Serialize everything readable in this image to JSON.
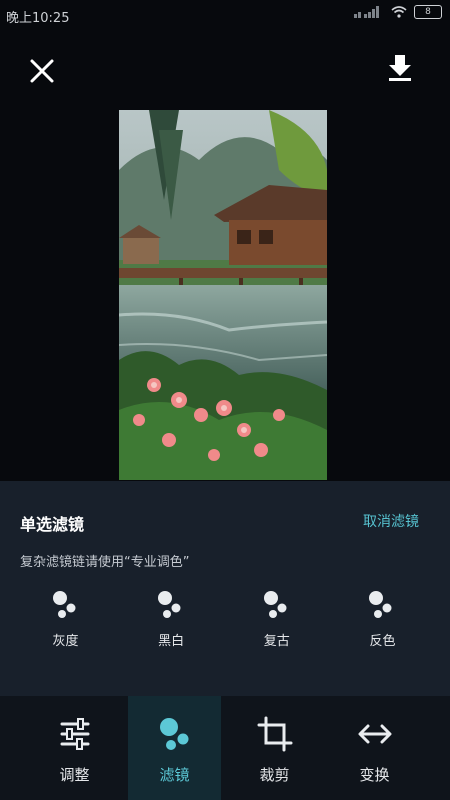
{
  "status_bar": {
    "time": "晚上10:25",
    "signal": "signal-icon",
    "wifi": "wifi-icon",
    "battery": "8"
  },
  "top_bar": {
    "close_icon": "close-icon",
    "download_icon": "download-icon"
  },
  "photo": {
    "description_icon": "photo-preview"
  },
  "filter_panel": {
    "title": "单选滤镜",
    "cancel": "取消滤镜",
    "hint": "复杂滤镜链请使用“专业调色”",
    "filters": [
      {
        "label": "灰度",
        "icon": "dots-icon"
      },
      {
        "label": "黑白",
        "icon": "dots-icon"
      },
      {
        "label": "复古",
        "icon": "dots-icon"
      },
      {
        "label": "反色",
        "icon": "dots-icon"
      }
    ]
  },
  "tabs": [
    {
      "label": "调整",
      "icon": "sliders-icon",
      "active": false
    },
    {
      "label": "滤镜",
      "icon": "dots-icon",
      "active": true
    },
    {
      "label": "裁剪",
      "icon": "crop-icon",
      "active": false
    },
    {
      "label": "变换",
      "icon": "swap-arrows-icon",
      "active": false
    }
  ],
  "colors": {
    "accent": "#56c1cf",
    "panel": "#18202b",
    "tabbar": "#0f141b",
    "active_tab": "#132a33"
  }
}
